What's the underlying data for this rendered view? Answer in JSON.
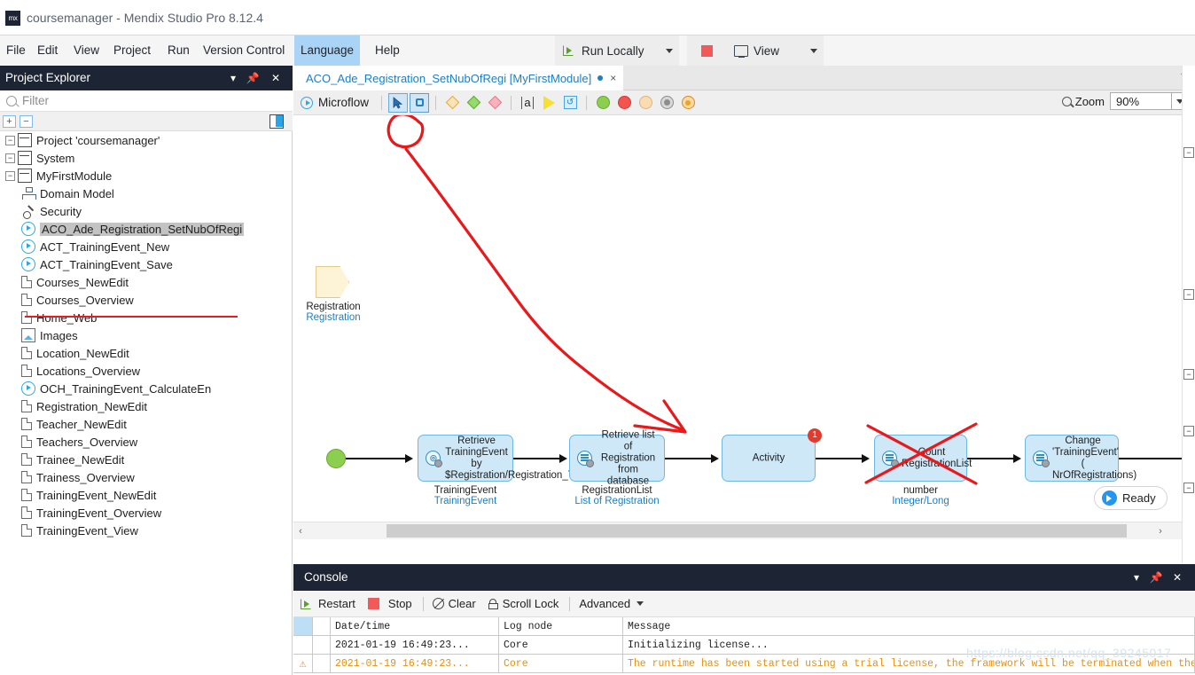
{
  "titlebar": {
    "app_title": "coursemanager - Mendix Studio Pro 8.12.4",
    "logo": "mx-logo"
  },
  "menubar": {
    "items": [
      {
        "label": "File"
      },
      {
        "label": "Edit"
      },
      {
        "label": "View"
      },
      {
        "label": "Project"
      },
      {
        "label": "Run"
      },
      {
        "label": "Version Control"
      },
      {
        "label": "Language",
        "selected": true
      },
      {
        "label": "Help"
      }
    ]
  },
  "runbar": {
    "run_label": "Run Locally",
    "run_icon": "run-locally-icon",
    "stop_icon": "stop-square-icon",
    "view_label": "View",
    "view_icon": "monitor-icon",
    "dropdown_icon": "chevron-down-icon"
  },
  "project_explorer": {
    "title": "Project Explorer",
    "header_buttons": [
      "chevron-down-icon",
      "pin-icon",
      "close-icon"
    ],
    "filter_placeholder": "Filter",
    "toolbar": {
      "expand_all": "+",
      "collapse_all": "−",
      "dock": "dock-icon"
    },
    "tree": [
      {
        "label": "Project 'coursemanager'",
        "icon": "cube-icon",
        "level": 1,
        "expander": "−"
      },
      {
        "label": "System",
        "icon": "module-icon",
        "level": 1,
        "expander": "−"
      },
      {
        "label": "MyFirstModule",
        "icon": "module-icon",
        "level": 1,
        "expander": "−"
      },
      {
        "label": "Domain Model",
        "icon": "domain-model-icon",
        "level": 2
      },
      {
        "label": "Security",
        "icon": "security-icon",
        "level": 2
      },
      {
        "label": "ACO_Ade_Registration_SetNubOfRegi",
        "icon": "microflow-icon",
        "level": 2,
        "selected": true
      },
      {
        "label": "ACT_TrainingEvent_New",
        "icon": "microflow-icon",
        "level": 2
      },
      {
        "label": "ACT_TrainingEvent_Save",
        "icon": "microflow-icon",
        "level": 2
      },
      {
        "label": "Courses_NewEdit",
        "icon": "page-icon",
        "level": 2
      },
      {
        "label": "Courses_Overview",
        "icon": "page-icon",
        "level": 2
      },
      {
        "label": "Home_Web",
        "icon": "page-icon",
        "level": 2
      },
      {
        "label": "Images",
        "icon": "images-icon",
        "level": 2
      },
      {
        "label": "Location_NewEdit",
        "icon": "page-icon",
        "level": 2
      },
      {
        "label": "Locations_Overview",
        "icon": "page-icon",
        "level": 2
      },
      {
        "label": "OCH_TrainingEvent_CalculateEn",
        "icon": "microflow-icon",
        "level": 2
      },
      {
        "label": "Registration_NewEdit",
        "icon": "page-icon",
        "level": 2
      },
      {
        "label": "Teacher_NewEdit",
        "icon": "page-icon",
        "level": 2
      },
      {
        "label": "Teachers_Overview",
        "icon": "page-icon",
        "level": 2
      },
      {
        "label": "Trainee_NewEdit",
        "icon": "page-icon",
        "level": 2
      },
      {
        "label": "Trainess_Overview",
        "icon": "page-icon",
        "level": 2
      },
      {
        "label": "TrainingEvent_NewEdit",
        "icon": "page-icon",
        "level": 2
      },
      {
        "label": "TrainingEvent_Overview",
        "icon": "page-icon",
        "level": 2
      },
      {
        "label": "TrainingEvent_View",
        "icon": "page-icon",
        "level": 2
      }
    ]
  },
  "editor": {
    "tab": {
      "label": "ACO_Ade_Registration_SetNubOfRegi [MyFirstModule]",
      "modified": true,
      "close": "×"
    },
    "toolbar": {
      "type_label": "Microflow",
      "tools": [
        {
          "name": "pointer-tool",
          "glyph": "arrow",
          "selected": true
        },
        {
          "name": "object-activity-tool",
          "glyph": "square",
          "selected": false
        },
        {
          "name": "exclusive-split-tool",
          "glyph": "diamond",
          "color": "#f5cf92"
        },
        {
          "name": "merge-tool",
          "glyph": "diamond",
          "color": "#8fd46a"
        },
        {
          "name": "error-handler-tool",
          "glyph": "diamond",
          "color": "#f2a0a8"
        },
        {
          "name": "annotation-tool",
          "glyph": "a"
        },
        {
          "name": "parameter-tool",
          "glyph": "parameter"
        },
        {
          "name": "loop-tool",
          "glyph": "loop"
        },
        {
          "name": "start-event-tool",
          "glyph": "circle",
          "color": "#8ccf4e"
        },
        {
          "name": "stop-event-tool",
          "glyph": "circle",
          "color": "#ef5350"
        },
        {
          "name": "continue-event-tool",
          "glyph": "circle",
          "color": "#fbd5a8"
        },
        {
          "name": "break-event-tool",
          "glyph": "circle",
          "color": "#9e9e9e"
        },
        {
          "name": "error-event-tool",
          "glyph": "circle",
          "color": "#f0a22e"
        }
      ]
    },
    "zoom": {
      "label": "Zoom",
      "value": "90%",
      "icon": "zoom-icon"
    },
    "status": {
      "label": "Ready",
      "icon": "ready-icon"
    }
  },
  "microflow": {
    "parameter": {
      "name": "Registration",
      "type": "Registration"
    },
    "nodes": [
      {
        "id": "retrieve-training-event",
        "text": "Retrieve TrainingEvent by $Registration/Registration_Traini",
        "caption": "TrainingEvent",
        "caption_type": "TrainingEvent",
        "icon": "retrieve-by-association-icon"
      },
      {
        "id": "retrieve-registration-list",
        "text": "Retrieve list of Registration from database",
        "caption": "RegistrationList",
        "caption_type": "List of Registration",
        "icon": "retrieve-from-database-icon"
      },
      {
        "id": "activity-placeholder",
        "text": "Activity",
        "caption": "",
        "caption_type": "",
        "badge": "1",
        "icon": ""
      },
      {
        "id": "count-registration-list",
        "text": "Count RegistrationList",
        "caption": "number",
        "caption_type": "Integer/Long",
        "icon": "aggregate-list-icon",
        "crossed_out": true
      },
      {
        "id": "change-training-event",
        "text": "Change 'TrainingEvent' ( NrOfRegistrations)",
        "caption": "",
        "caption_type": "",
        "icon": "change-object-icon"
      }
    ],
    "annotations": [
      {
        "type": "circle-highlight",
        "target": "object-activity-tool",
        "color": "#e8181b"
      },
      {
        "type": "arrow",
        "from": "object-activity-tool",
        "to": "activity-placeholder",
        "color": "#e8181b"
      },
      {
        "type": "cross-out",
        "target": "count-registration-list",
        "color": "#e8181b"
      },
      {
        "type": "underline",
        "target": "tree-item-aco",
        "color": "#e02020"
      }
    ]
  },
  "console": {
    "title": "Console",
    "header_buttons": [
      "chevron-down-icon",
      "pin-icon",
      "close-icon"
    ],
    "toolbar": [
      {
        "label": "Restart",
        "icon": "restart-icon"
      },
      {
        "label": "Stop",
        "icon": "stop-icon"
      },
      {
        "label": "Clear",
        "icon": "clear-icon"
      },
      {
        "label": "Scroll Lock",
        "icon": "lock-icon"
      },
      {
        "label": "Advanced",
        "icon": "chevron-down-icon"
      }
    ],
    "columns": [
      "",
      "",
      "Date/time",
      "Log node",
      "Message"
    ],
    "rows": [
      {
        "severity": "",
        "datetime": "2021-01-19 16:49:23...",
        "log_node": "Core",
        "message": "Initializing license...",
        "warning": false
      },
      {
        "severity": "warning-icon",
        "datetime": "2021-01-19 16:49:23...",
        "log_node": "Core",
        "message": "The runtime has been started using a trial license, the framework will be terminated when the maximum tim...",
        "warning": true
      }
    ]
  },
  "watermark": {
    "text": "https://blog.csdn.net/qq_39245017"
  },
  "colors": {
    "accent_blue": "#1b7fc4",
    "panel_dark": "#1d2433",
    "annotation_red": "#e8181b",
    "node_fill": "#cfe8f7",
    "node_border": "#6fb8e0",
    "warning_orange": "#e8900c",
    "start_green": "#8ccf4e"
  }
}
